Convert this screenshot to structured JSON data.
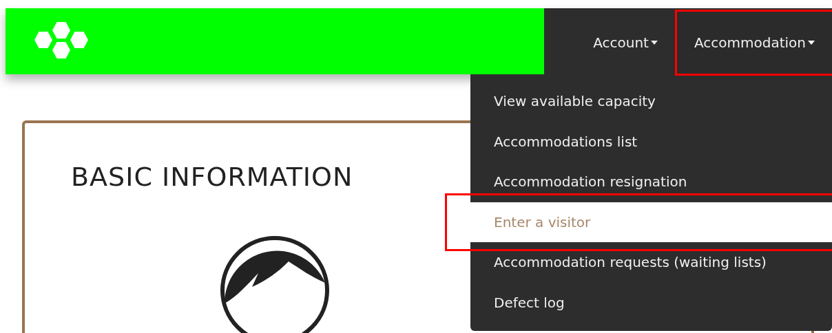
{
  "nav": [
    {
      "label": "Account",
      "selected": false,
      "highlighted": false
    },
    {
      "label": "Accommodation",
      "selected": true,
      "highlighted": true
    }
  ],
  "dropdown": {
    "items": [
      {
        "label": "View available capacity",
        "selected": false,
        "highlighted": false
      },
      {
        "label": "Accommodations list",
        "selected": false,
        "highlighted": false
      },
      {
        "label": "Accommodation resignation",
        "selected": false,
        "highlighted": false
      },
      {
        "label": "Enter a visitor",
        "selected": true,
        "highlighted": true
      },
      {
        "label": "Accommodation requests (waiting lists)",
        "selected": false,
        "highlighted": false
      },
      {
        "label": "Defect log",
        "selected": false,
        "highlighted": false
      }
    ]
  },
  "card": {
    "title": "BASIC INFORMATION"
  }
}
